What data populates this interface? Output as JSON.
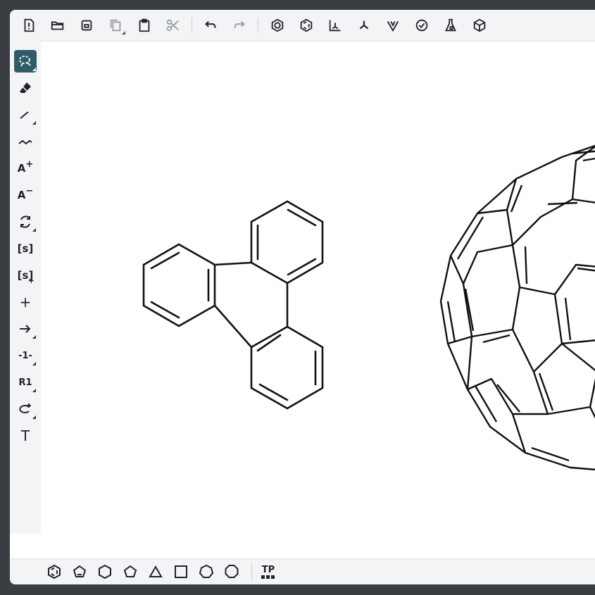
{
  "top_toolbar": {
    "tools": [
      {
        "name": "new-file"
      },
      {
        "name": "open"
      },
      {
        "name": "save"
      },
      {
        "name": "copy"
      },
      {
        "name": "paste"
      },
      {
        "name": "cut"
      },
      {
        "name": "undo"
      },
      {
        "name": "redo"
      },
      {
        "name": "aromatize"
      },
      {
        "name": "dearomatize"
      },
      {
        "name": "layout"
      },
      {
        "name": "clean-up"
      },
      {
        "name": "calculate-cip"
      },
      {
        "name": "check-structure"
      },
      {
        "name": "calculated-values"
      },
      {
        "name": "3d-viewer"
      }
    ]
  },
  "left_toolbar": {
    "tools": [
      {
        "name": "select",
        "active": true
      },
      {
        "name": "eraser"
      },
      {
        "name": "single-bond"
      },
      {
        "name": "chain"
      },
      {
        "name": "charge-plus",
        "label": "A",
        "sup": "+"
      },
      {
        "name": "charge-minus",
        "label": "A",
        "sup": "−"
      },
      {
        "name": "rotate"
      },
      {
        "name": "sgroup",
        "label": "[s]"
      },
      {
        "name": "sgroup-add",
        "label": "[s]"
      },
      {
        "name": "plus",
        "label": "+"
      },
      {
        "name": "reaction-arrow"
      },
      {
        "name": "reaction-mapping",
        "label": "-1-"
      },
      {
        "name": "rgroup",
        "label": "R1"
      },
      {
        "name": "attachment-point"
      },
      {
        "name": "text-tool",
        "label": "T"
      }
    ]
  },
  "bottom_toolbar": {
    "templates": [
      "benzene",
      "cyclopentadiene",
      "cyclohexane",
      "cyclopentane",
      "cyclopropane",
      "cyclobutane",
      "cycloheptane",
      "cyclooctane"
    ],
    "template_library_label": "TP"
  },
  "colors": {
    "accent": "#2f5c68",
    "toolbar_bg": "#f3f4f6",
    "frame_bg": "#3a3d42"
  }
}
